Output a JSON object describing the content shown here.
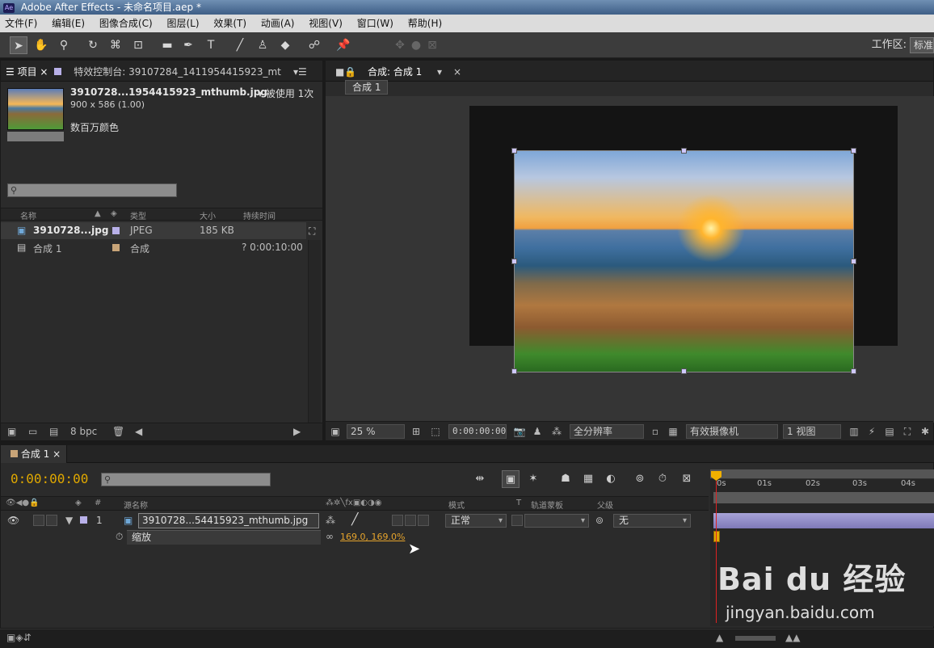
{
  "window": {
    "title": "Adobe After Effects - 未命名项目.aep *",
    "app_icon": "Ae"
  },
  "menubar": {
    "items": [
      "文件(F)",
      "编辑(E)",
      "图像合成(C)",
      "图层(L)",
      "效果(T)",
      "动画(A)",
      "视图(V)",
      "窗口(W)",
      "帮助(H)"
    ]
  },
  "toolbar": {
    "workspace_label": "工作区:",
    "workspace_value": "标准"
  },
  "project_panel": {
    "tab_project": "项目",
    "tab_effects": "特效控制台: 39107284_1411954415923_mt",
    "asset": {
      "name": "3910728...1954415923_mthumb.jpg",
      "used": "▾ 被使用 1次",
      "dimensions": "900 x 586 (1.00)",
      "colors": "数百万颜色"
    },
    "columns": [
      "名称",
      "类型",
      "大小",
      "持续时间"
    ],
    "items": [
      {
        "name": "3910728...jpg",
        "type": "JPEG",
        "size": "185 KB",
        "duration": "",
        "swatch": "#b8b0e8"
      },
      {
        "name": "合成 1",
        "type": "合成",
        "size": "",
        "duration": "? 0:00:10:00",
        "swatch": "#c8a478"
      }
    ],
    "bpc": "8 bpc"
  },
  "comp_panel": {
    "tab_label": "合成: 合成 1",
    "breadcrumb": "合成 1",
    "zoom": "25 %",
    "timecode": "0:00:00:00",
    "resolution": "全分辨率",
    "camera": "有效摄像机",
    "views": "1 视图"
  },
  "timeline": {
    "tab_label": "合成 1",
    "timecode": "0:00:00:00",
    "columns": {
      "source_name": "源名称",
      "mode": "模式",
      "trkmat_t": "T",
      "trkmat": "轨道蒙板",
      "parent": "父级",
      "num": "#"
    },
    "layer": {
      "index": "1",
      "name": "3910728...54415923_mthumb.jpg",
      "mode": "正常",
      "parent": "无"
    },
    "property": {
      "name": "缩放",
      "value": "169.0, 169.0%"
    },
    "ruler_ticks": [
      "0s",
      "01s",
      "02s",
      "03s",
      "04s"
    ]
  },
  "watermark": {
    "logo": "Bai du 经验",
    "sub": "jingyan.baidu.com"
  },
  "colors": {
    "accent_timecode": "#e0a800",
    "layer_bar": "#8c87c4",
    "playhead": "#dd2222"
  }
}
